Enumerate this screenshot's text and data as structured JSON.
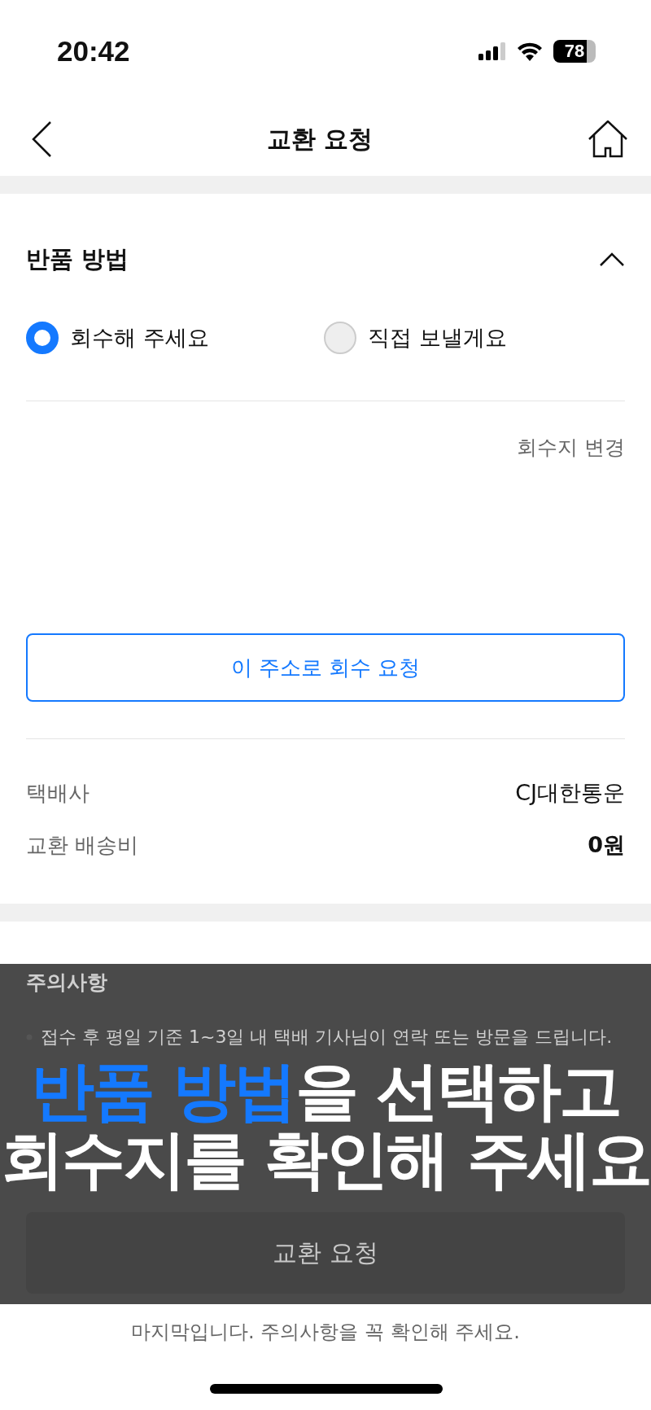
{
  "status_bar": {
    "time": "20:42",
    "battery": "78"
  },
  "nav": {
    "title": "교환 요청"
  },
  "return_method": {
    "title": "반품 방법",
    "expanded": true,
    "options": [
      {
        "label": "회수해 주세요",
        "selected": true
      },
      {
        "label": "직접 보낼게요",
        "selected": false
      }
    ],
    "change_address": "회수지 변경",
    "request_button": "이 주소로 회수 요청"
  },
  "shipping": [
    {
      "label": "택배사",
      "value": "CJ대한통운",
      "bold": false
    },
    {
      "label": "교환 배송비",
      "value": "0원",
      "bold": true
    }
  ],
  "notice": {
    "title": "주의사항",
    "items": [
      "접수 후 평일 기준 1~3일 내 택배 기사님이 연락 또는 방문을 드립니다."
    ]
  },
  "submit_button": "교환 요청",
  "caption": {
    "lines": [
      {
        "highlight": "반품 방법",
        "text": "을 선택하고"
      },
      {
        "text": "회수지를 확인해 주세요"
      }
    ]
  },
  "footer": "마지막입니다. 주의사항을 꼭 확인해 주세요."
}
